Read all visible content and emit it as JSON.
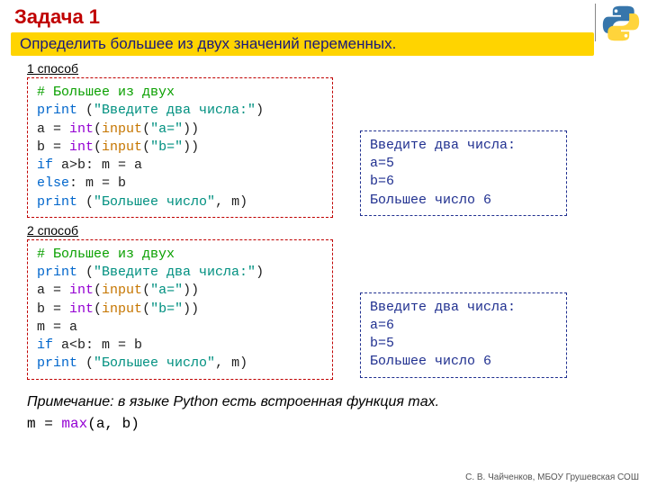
{
  "title": "Задача 1",
  "subtitle": "Определить большее из двух значений переменных.",
  "method1_label": "1 способ",
  "method2_label": "2 способ",
  "code1": {
    "l1": "# Большее из двух",
    "l2a": "print",
    "l2b": " (",
    "l2c": "\"Введите два числа:\"",
    "l2d": ")",
    "l3a": "a = ",
    "l3b": "int",
    "l3c": "(",
    "l3d": "input",
    "l3e": "(",
    "l3f": "\"a=\"",
    "l3g": "))",
    "l4a": "b = ",
    "l4b": "int",
    "l4c": "(",
    "l4d": "input",
    "l4e": "(",
    "l4f": "\"b=\"",
    "l4g": "))",
    "l5a": "if",
    "l5b": " a>b: m = a",
    "l6a": "else",
    "l6b": ": m = b",
    "l7a": "print",
    "l7b": " (",
    "l7c": "\"Большее число\"",
    "l7d": ", m)"
  },
  "out1": {
    "l1": "Введите два числа:",
    "l2": "a=5",
    "l3": "b=6",
    "l4": "Большее число 6"
  },
  "code2": {
    "l1": "# Большее из двух",
    "l2a": "print",
    "l2b": " (",
    "l2c": "\"Введите два числа:\"",
    "l2d": ")",
    "l3a": "a = ",
    "l3b": "int",
    "l3c": "(",
    "l3d": "input",
    "l3e": "(",
    "l3f": "\"a=\"",
    "l3g": "))",
    "l4a": "b = ",
    "l4b": "int",
    "l4c": "(",
    "l4d": "input",
    "l4e": "(",
    "l4f": "\"b=\"",
    "l4g": "))",
    "l5": "m = a",
    "l6a": "if",
    "l6b": " a<b: m = b",
    "l7a": "print",
    "l7b": " (",
    "l7c": "\"Большее число\"",
    "l7d": ", m)"
  },
  "out2": {
    "l1": "Введите два числа:",
    "l2": "a=6",
    "l3": "b=5",
    "l4": "Большее число 6"
  },
  "note": "Примечание: в языке Python есть встроенная функция max.",
  "maxline_a": "m = ",
  "maxline_b": "max",
  "maxline_c": "(a, b)",
  "credit": "С. В. Чайченков, МБОУ Грушевская СОШ"
}
